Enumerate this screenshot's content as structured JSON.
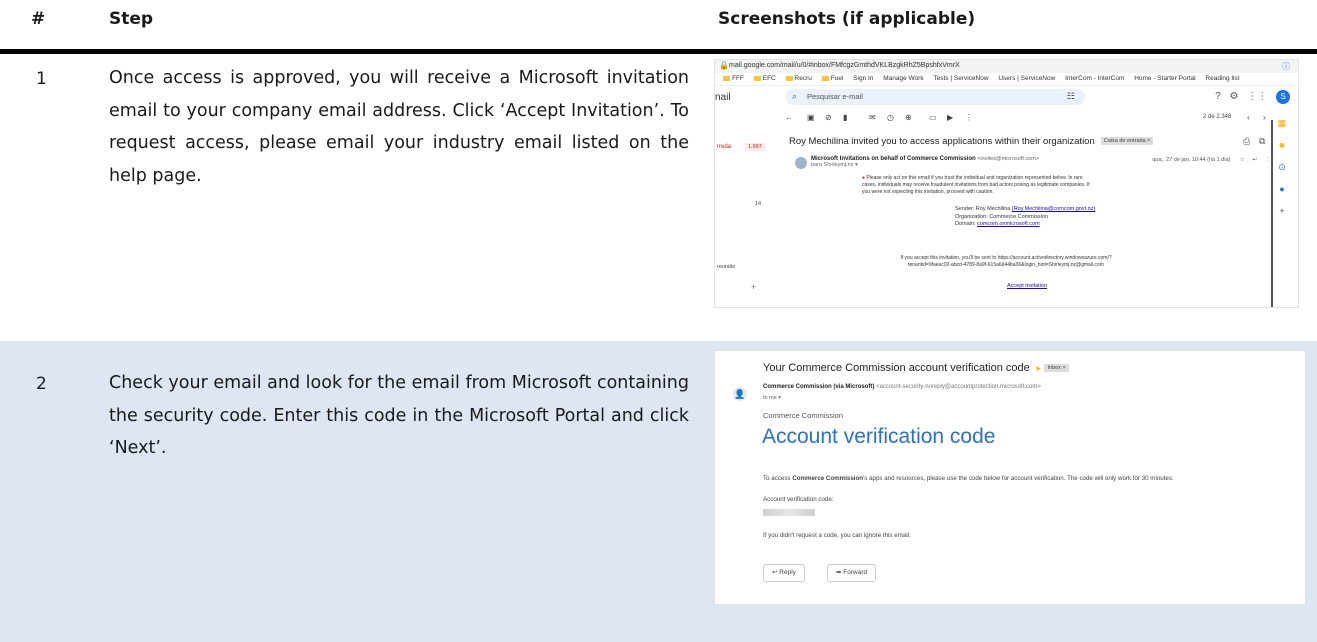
{
  "table": {
    "headers": {
      "num": "#",
      "step": "Step",
      "screenshots": "Screenshots (if applicable)"
    },
    "rows": [
      {
        "num": "1",
        "text": "Once access is approved, you will receive a Microsoft invitation email to your company email address. Click ‘Accept Invitation’. To request access, please email your industry email listed on the help page."
      },
      {
        "num": "2",
        "text": "Check your email and look for the email from Microsoft containing the security code. Enter this code in the Microsoft Portal and click ‘Next’."
      }
    ]
  },
  "screenshot1": {
    "url": "mail.google.com/mail/u/0/#inbox/FMfcgzGmthdVKLBzgkRhZ5BpshfxVmrX",
    "bookmarks": [
      "FFF",
      "EFC",
      "Recru",
      "Fuel",
      "Sign In",
      "Manage Work",
      "Tests | ServiceNow",
      "Users | ServiceNow",
      "InterCom - InterCom",
      "Home - Starter Portal"
    ],
    "reading_list": "Reading list",
    "app_label": "nail",
    "search_placeholder": "Pesquisar e-mail",
    "avatar_letter": "S",
    "pager": "2 de 2.348",
    "side_badge_label": "rreda",
    "side_badge_count": "1.997",
    "side_count": "14",
    "side_reuniao": "reunião",
    "subject": "Roy Mechilina invited you to access applications within their organization",
    "inbox_tag": "Caixa de entrada ×",
    "from_name": "Microsoft Invitations on behalf of Commerce Commission",
    "from_addr": "<invites@microsoft.com>",
    "to": "para Shirleymj.nz ▾",
    "date": "qua., 27 de jan. 10:44 (há 1 dia)",
    "warning": "Please only act on this email if you trust the individual and organization represented below. In rare cases, individuals may receive fraudulent invitations from bad actors posing as legitimate companies. If you were not expecting this invitation, proceed with caution.",
    "sender_label": "Sender:",
    "sender_value": "Roy Mechilina",
    "sender_email": "(Roy.Mechilina@comcom.govt.nz)",
    "org_label": "Organization:",
    "org_value": "Commerce Commission",
    "domain_label": "Domain:",
    "domain_value": "comcom.onmicrosoft.com",
    "accept_text": "If you accept this invitation, you'll be sent to https://account.activedirectory.windowsazure.com/?tenantid=9faeac02-abcd-4789-8a9f-615a6d44ba36&login_hint=Shirleymj.nz@gmail.com",
    "accept_link": "Accept invitation"
  },
  "screenshot2": {
    "subject": "Your Commerce Commission account verification code",
    "inbox_tag": "Inbox ×",
    "from_name": "Commerce Commission (via Microsoft)",
    "from_addr": "<account-security-noreply@accountprotection.microsoft.com>",
    "to": "to me ▾",
    "org": "Commerce Commission",
    "title": "Account verification code",
    "body_prefix": "To access ",
    "body_bold": "Commerce Commission",
    "body_suffix": "'s apps and resources, please use the code below for account verification. The code will only work for 30 minutes.",
    "code_label": "Account verification code:",
    "ignore_text": "If you didn't request a code, you can ignore this email.",
    "reply": "Reply",
    "forward": "Forward"
  }
}
